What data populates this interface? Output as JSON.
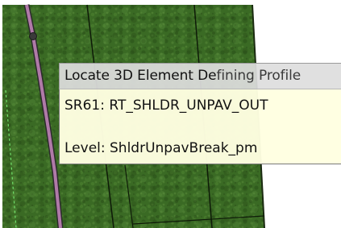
{
  "command_prompt": {
    "text_part1": "Locate 3D Element De",
    "text_part2": "fining Profile"
  },
  "element_tooltip": {
    "element_name": "SR61: RT_SHLDR_UNPAV_OUT",
    "level": "Level: ShldrUnpavBreak_pm"
  },
  "colors": {
    "grass_dark": "#2f5a1c",
    "grass_light": "#4b7a30",
    "highlight_line": "#b07aa8",
    "tooltip_bg": "#ffffe1",
    "prompt_bg": "#dedede"
  }
}
